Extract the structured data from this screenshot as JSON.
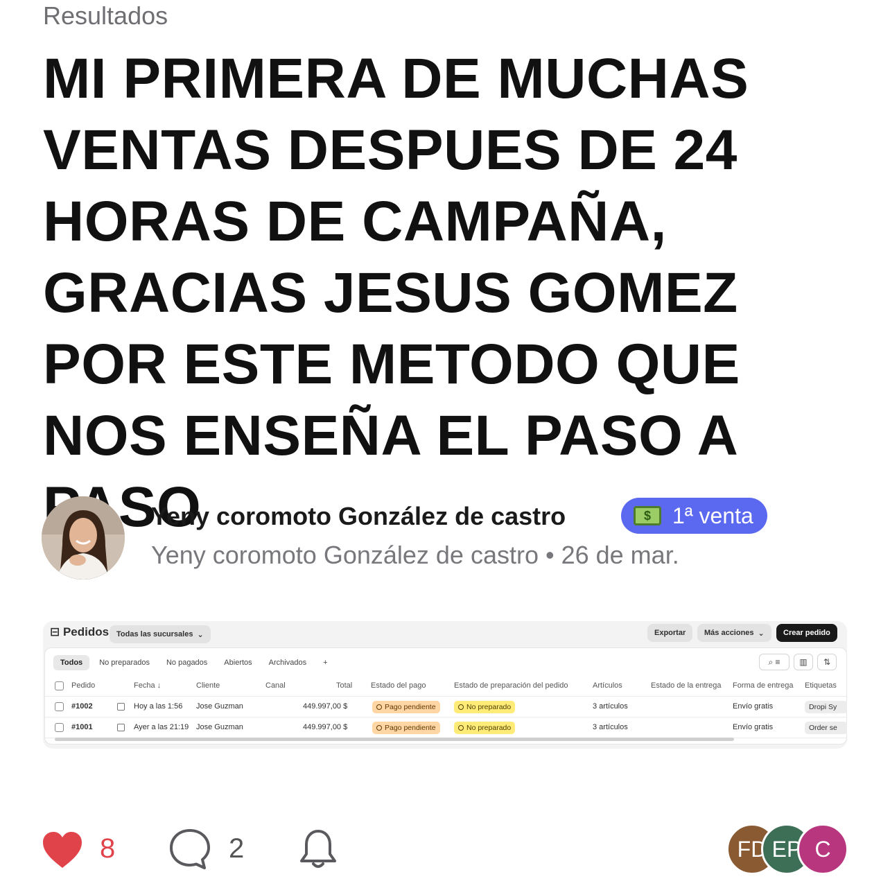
{
  "header": {
    "section": "Resultados"
  },
  "post": {
    "title": "MI PRIMERA DE MUCHAS VENTAS DESPUES DE 24 HORAS DE CAMPAÑA, GRACIAS JESUS GOMEZ POR ESTE METODO QUE NOS ENSEÑA EL PASO A PASO"
  },
  "author": {
    "name": "Yeny coromoto González de castro",
    "badge_icon": "money-bill-emoji",
    "badge_label": "1ª venta",
    "meta_name": "Yeny coromoto González de castro",
    "meta_separator": "•",
    "date": "26 de mar."
  },
  "orders": {
    "title": "Pedidos",
    "branch_select": "Todas las sucursales",
    "export": "Exportar",
    "more_actions": "Más acciones",
    "create": "Crear pedido",
    "tabs": [
      "Todos",
      "No preparados",
      "No pagados",
      "Abiertos",
      "Archivados",
      "+"
    ],
    "columns": [
      "Pedido",
      "Fecha ↓",
      "Cliente",
      "Canal",
      "Total",
      "Estado del pago",
      "Estado de preparación del pedido",
      "Artículos",
      "Estado de la entrega",
      "Forma de entrega",
      "Etiquetas"
    ],
    "rows": [
      {
        "id": "#1002",
        "date": "Hoy a las 1:56",
        "client": "Jose Guzman",
        "channel": "",
        "total": "449.997,00 $",
        "payment": "Pago pendiente",
        "prep": "No preparado",
        "items": "3 artículos",
        "delivery_status": "",
        "delivery": "Envío gratis",
        "label": "Dropi Sy"
      },
      {
        "id": "#1001",
        "date": "Ayer a las 21:19",
        "client": "Jose Guzman",
        "channel": "",
        "total": "449.997,00 $",
        "payment": "Pago pendiente",
        "prep": "No preparado",
        "items": "3 artículos",
        "delivery_status": "",
        "delivery": "Envío gratis",
        "label": "Order se"
      }
    ]
  },
  "actions": {
    "likes": "8",
    "comments": "2",
    "participants": [
      "FD",
      "EP",
      "C"
    ],
    "colors": {
      "like": "#e0444a",
      "badge": "#5b68f0"
    }
  }
}
